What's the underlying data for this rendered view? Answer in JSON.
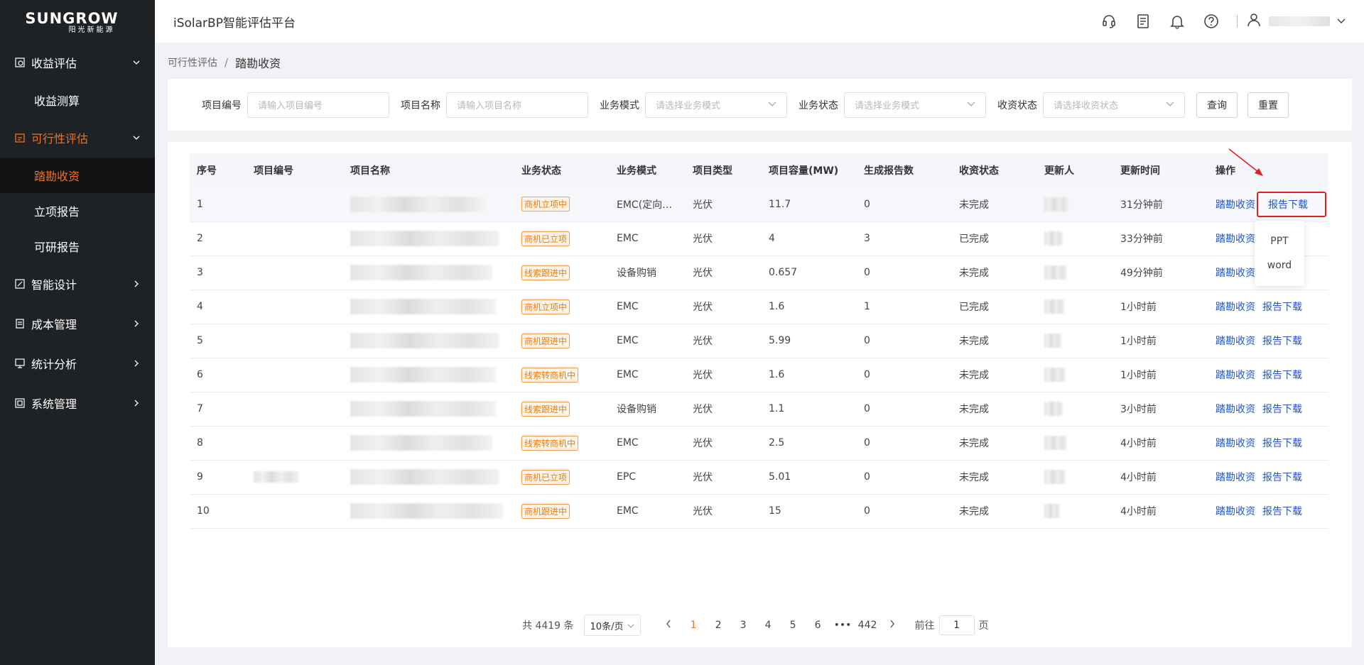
{
  "logo": {
    "brand": "SUNGROW",
    "sub": "阳光新能源"
  },
  "sidebar": {
    "groups": [
      {
        "label": "收益评估",
        "icon": "revenue-icon",
        "children": [
          "收益测算"
        ]
      },
      {
        "label": "可行性评估",
        "icon": "feasibility-icon",
        "children": [
          "踏勘收资",
          "立项报告",
          "可研报告"
        ]
      },
      {
        "label": "智能设计",
        "icon": "design-icon"
      },
      {
        "label": "成本管理",
        "icon": "cost-icon"
      },
      {
        "label": "统计分析",
        "icon": "stats-icon"
      },
      {
        "label": "系统管理",
        "icon": "system-icon"
      }
    ]
  },
  "header": {
    "title": "iSolarBP智能评估平台"
  },
  "breadcrumb": {
    "parent": "可行性评估",
    "sep": "/",
    "current": "踏勘收资"
  },
  "filters": {
    "project_no": {
      "label": "项目编号",
      "placeholder": "请输入项目编号"
    },
    "project_name": {
      "label": "项目名称",
      "placeholder": "请输入项目名称"
    },
    "biz_mode": {
      "label": "业务模式",
      "placeholder": "请选择业务模式"
    },
    "biz_status": {
      "label": "业务状态",
      "placeholder": "请选择业务模式"
    },
    "collect_status": {
      "label": "收资状态",
      "placeholder": "请选择收资状态"
    },
    "query": "查询",
    "reset": "重置"
  },
  "table": {
    "columns": [
      "序号",
      "项目编号",
      "项目名称",
      "业务状态",
      "业务模式",
      "项目类型",
      "项目容量(MW)",
      "生成报告数",
      "收资状态",
      "更新人",
      "更新时间",
      "操作"
    ],
    "action_survey": "踏勘收资",
    "action_report": "报告下载",
    "rows": [
      {
        "no": "1",
        "status": "商机立项中",
        "mode": "EMC(定向…",
        "type": "光伏",
        "cap": "11.7",
        "reports": "0",
        "collect": "未完成",
        "time": "31分钟前"
      },
      {
        "no": "2",
        "status": "商机已立项",
        "mode": "EMC",
        "type": "光伏",
        "cap": "4",
        "reports": "3",
        "collect": "已完成",
        "time": "33分钟前"
      },
      {
        "no": "3",
        "status": "线索跟进中",
        "mode": "设备购销",
        "type": "光伏",
        "cap": "0.657",
        "reports": "0",
        "collect": "未完成",
        "time": "49分钟前"
      },
      {
        "no": "4",
        "status": "商机立项中",
        "mode": "EMC",
        "type": "光伏",
        "cap": "1.6",
        "reports": "1",
        "collect": "已完成",
        "time": "1小时前"
      },
      {
        "no": "5",
        "status": "商机跟进中",
        "mode": "EMC",
        "type": "光伏",
        "cap": "5.99",
        "reports": "0",
        "collect": "未完成",
        "time": "1小时前"
      },
      {
        "no": "6",
        "status": "线索转商机中",
        "mode": "EMC",
        "type": "光伏",
        "cap": "1.6",
        "reports": "0",
        "collect": "未完成",
        "time": "1小时前"
      },
      {
        "no": "7",
        "status": "线索跟进中",
        "mode": "设备购销",
        "type": "光伏",
        "cap": "1.1",
        "reports": "0",
        "collect": "未完成",
        "time": "3小时前"
      },
      {
        "no": "8",
        "status": "线索转商机中",
        "mode": "EMC",
        "type": "光伏",
        "cap": "2.5",
        "reports": "0",
        "collect": "未完成",
        "time": "4小时前"
      },
      {
        "no": "9",
        "status": "商机已立项",
        "mode": "EPC",
        "type": "光伏",
        "cap": "5.01",
        "reports": "0",
        "collect": "未完成",
        "time": "4小时前"
      },
      {
        "no": "10",
        "status": "商机跟进中",
        "mode": "EMC",
        "type": "光伏",
        "cap": "15",
        "reports": "0",
        "collect": "未完成",
        "time": "4小时前"
      }
    ]
  },
  "dropdown": {
    "items": [
      "PPT",
      "word"
    ]
  },
  "pagination": {
    "total": "共 4419 条",
    "page_size": "10条/页",
    "pages": [
      "1",
      "2",
      "3",
      "4",
      "5",
      "6",
      "•••",
      "442"
    ],
    "current": "1",
    "goto_prefix": "前往",
    "goto_value": "1",
    "goto_suffix": "页"
  }
}
